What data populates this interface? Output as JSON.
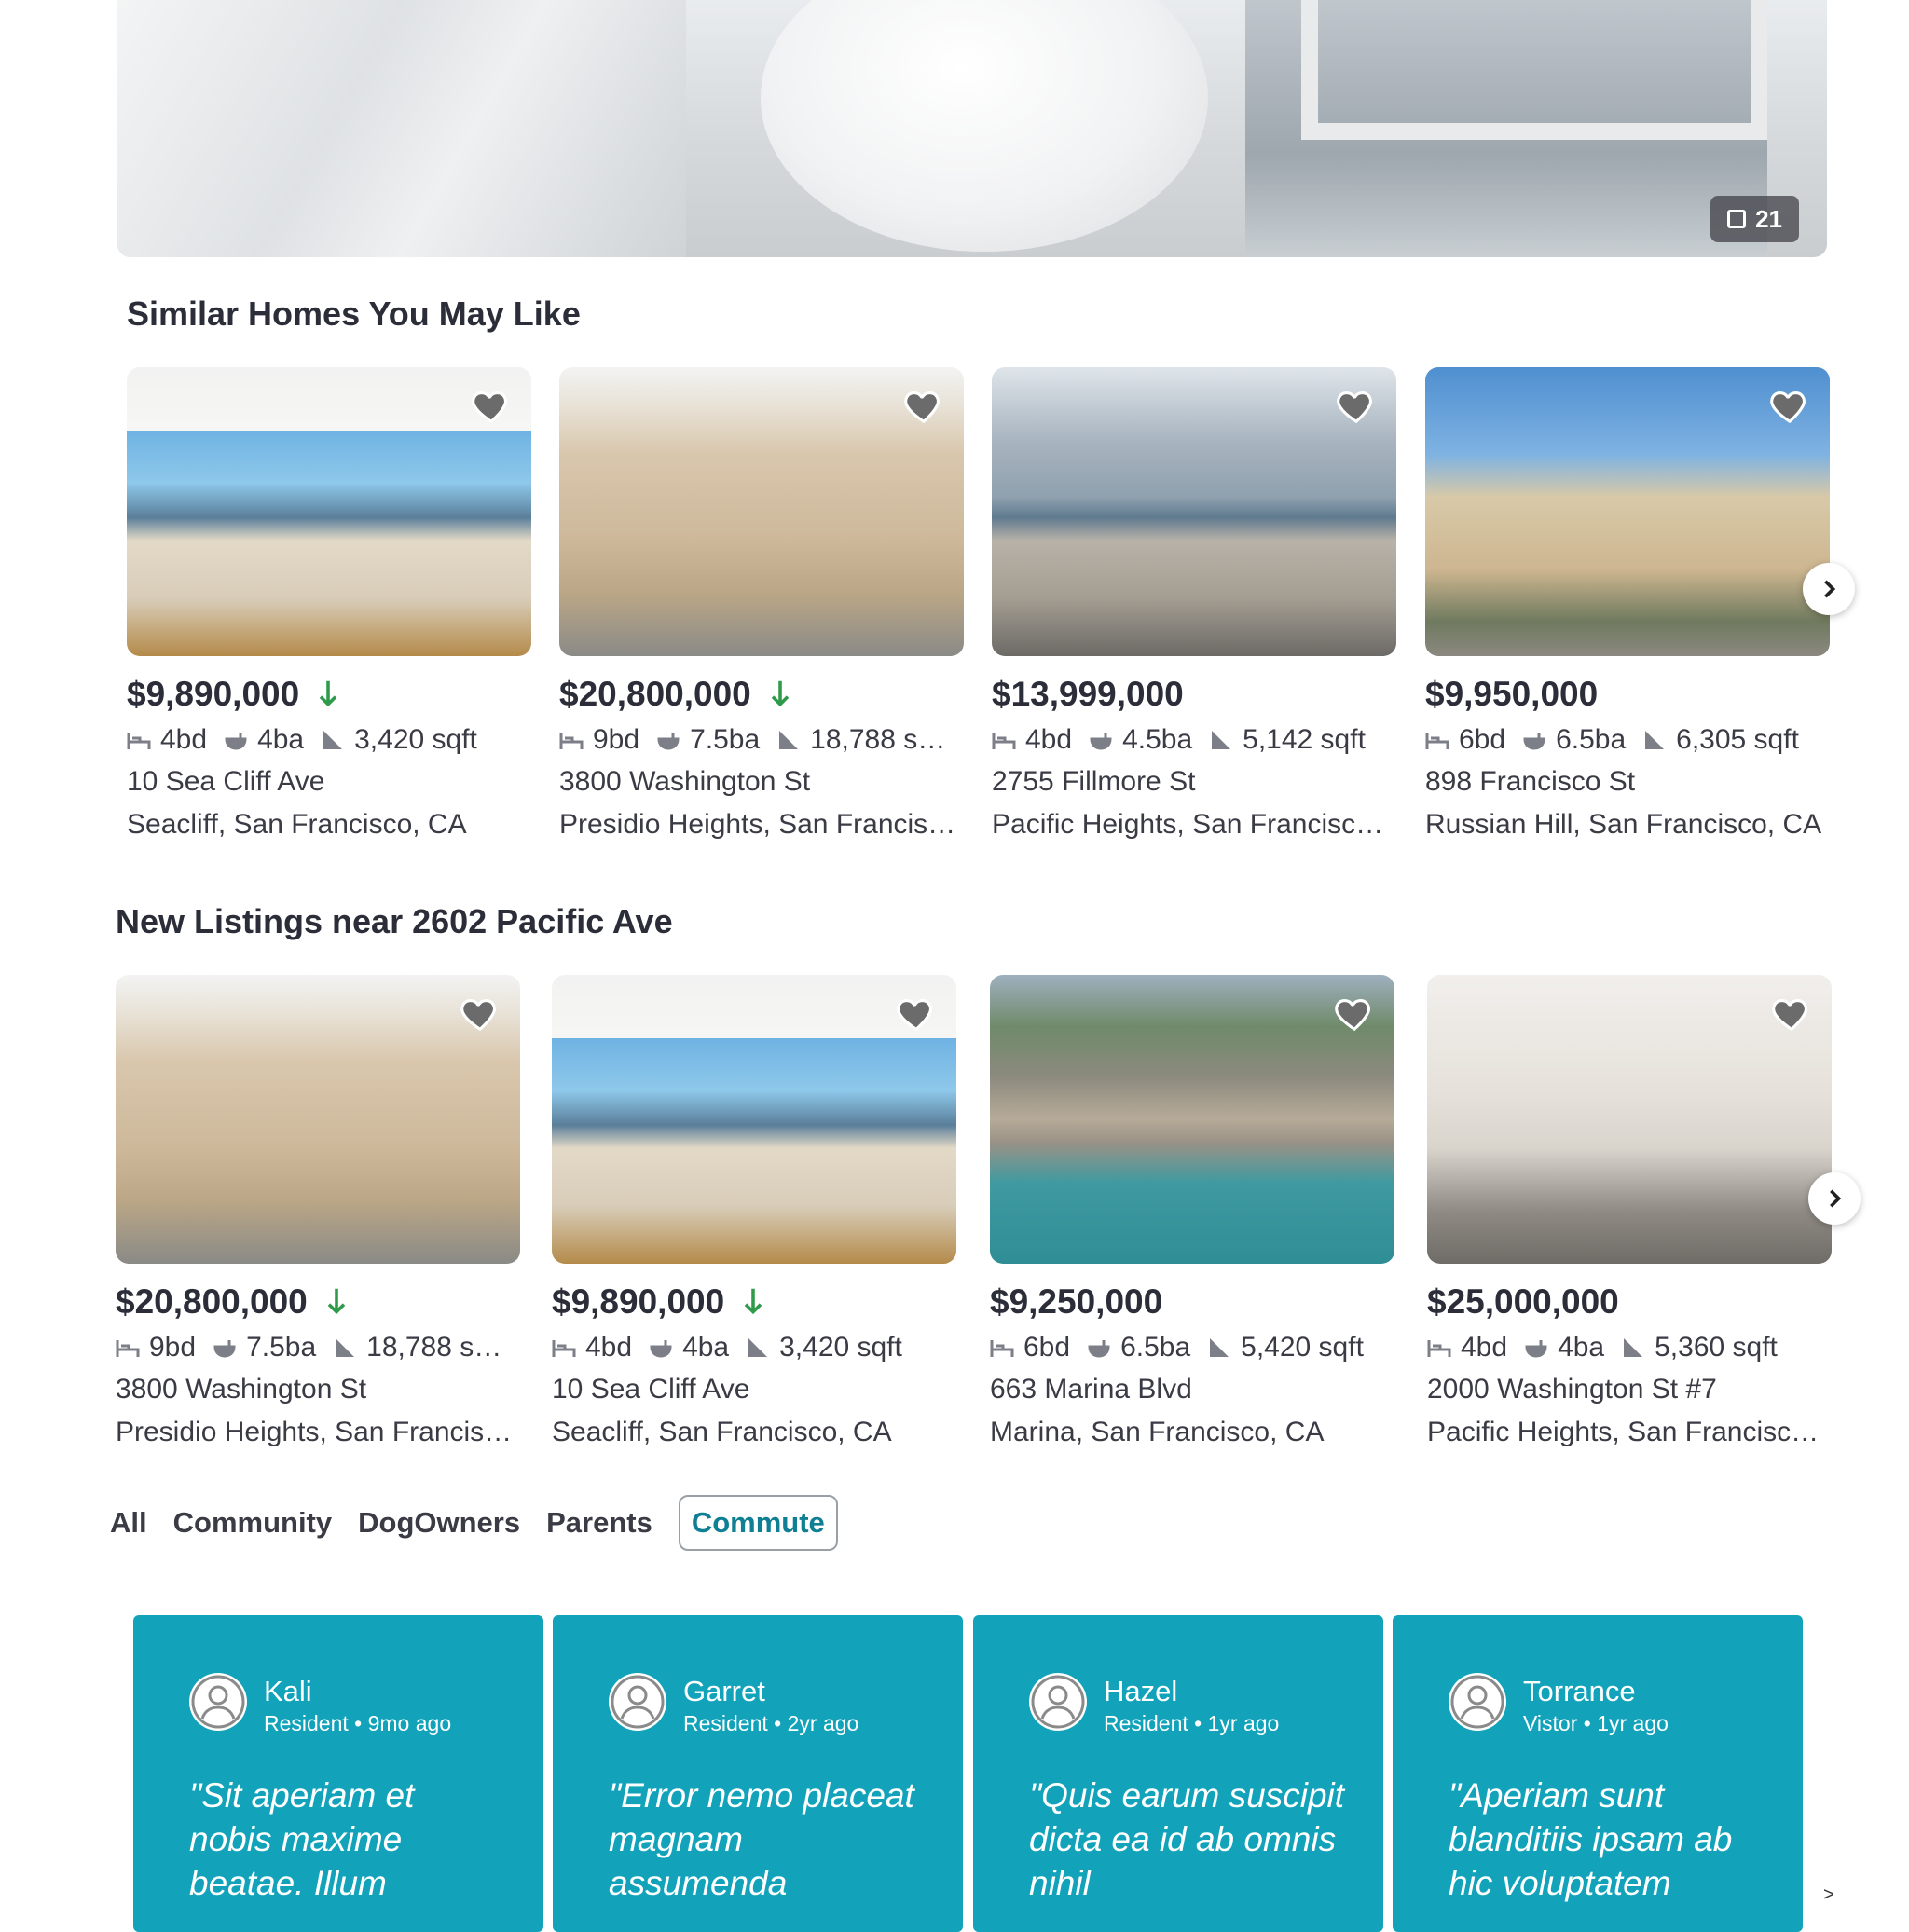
{
  "hero": {
    "photo_count": "21"
  },
  "similar": {
    "title": "Similar Homes You May Like",
    "cards": [
      {
        "price": "$9,890,000",
        "reduced": true,
        "beds": "4bd",
        "baths": "4ba",
        "sqft": "3,420 sqft",
        "address": "10 Sea Cliff Ave",
        "area": "Seacliff, San Francisco, CA"
      },
      {
        "price": "$20,800,000",
        "reduced": true,
        "beds": "9bd",
        "baths": "7.5ba",
        "sqft": "18,788 s…",
        "address": "3800 Washington St",
        "area": "Presidio Heights, San Francis…"
      },
      {
        "price": "$13,999,000",
        "reduced": false,
        "beds": "4bd",
        "baths": "4.5ba",
        "sqft": "5,142 sqft",
        "address": "2755 Fillmore St",
        "area": "Pacific Heights, San Francisc…"
      },
      {
        "price": "$9,950,000",
        "reduced": false,
        "beds": "6bd",
        "baths": "6.5ba",
        "sqft": "6,305 sqft",
        "address": "898 Francisco St",
        "area": "Russian Hill, San Francisco, CA"
      }
    ]
  },
  "newlistings": {
    "title": "New Listings near 2602 Pacific Ave",
    "cards": [
      {
        "price": "$20,800,000",
        "reduced": true,
        "beds": "9bd",
        "baths": "7.5ba",
        "sqft": "18,788 s…",
        "address": "3800 Washington St",
        "area": "Presidio Heights, San Francis…"
      },
      {
        "price": "$9,890,000",
        "reduced": true,
        "beds": "4bd",
        "baths": "4ba",
        "sqft": "3,420 sqft",
        "address": "10 Sea Cliff Ave",
        "area": "Seacliff, San Francisco, CA"
      },
      {
        "price": "$9,250,000",
        "reduced": false,
        "beds": "6bd",
        "baths": "6.5ba",
        "sqft": "5,420 sqft",
        "address": "663 Marina Blvd",
        "area": "Marina, San Francisco, CA"
      },
      {
        "price": "$25,000,000",
        "reduced": false,
        "beds": "4bd",
        "baths": "4ba",
        "sqft": "5,360 sqft",
        "address": "2000 Washington St #7",
        "area": "Pacific Heights, San Francisc…"
      }
    ]
  },
  "filters": {
    "items": [
      "All",
      "Community",
      "DogOwners",
      "Parents",
      "Commute"
    ],
    "active": "Commute"
  },
  "reviews": [
    {
      "name": "Kali",
      "meta": "Resident • 9mo ago",
      "quote": "\"Sit aperiam et nobis maxime beatae. Illum"
    },
    {
      "name": "Garret",
      "meta": "Resident • 2yr ago",
      "quote": "\"Error nemo placeat magnam assumenda"
    },
    {
      "name": "Hazel",
      "meta": "Resident • 1yr ago",
      "quote": "\"Quis earum suscipit dicta ea id ab omnis nihil"
    },
    {
      "name": "Torrance",
      "meta": "Vistor • 1yr ago",
      "quote": "\"Aperiam sunt blanditiis ipsam ab hic voluptatem"
    }
  ],
  "colors": {
    "accent": "#0f7f93",
    "review_bg": "#12a3bb",
    "price_down": "#2e9a4a"
  }
}
